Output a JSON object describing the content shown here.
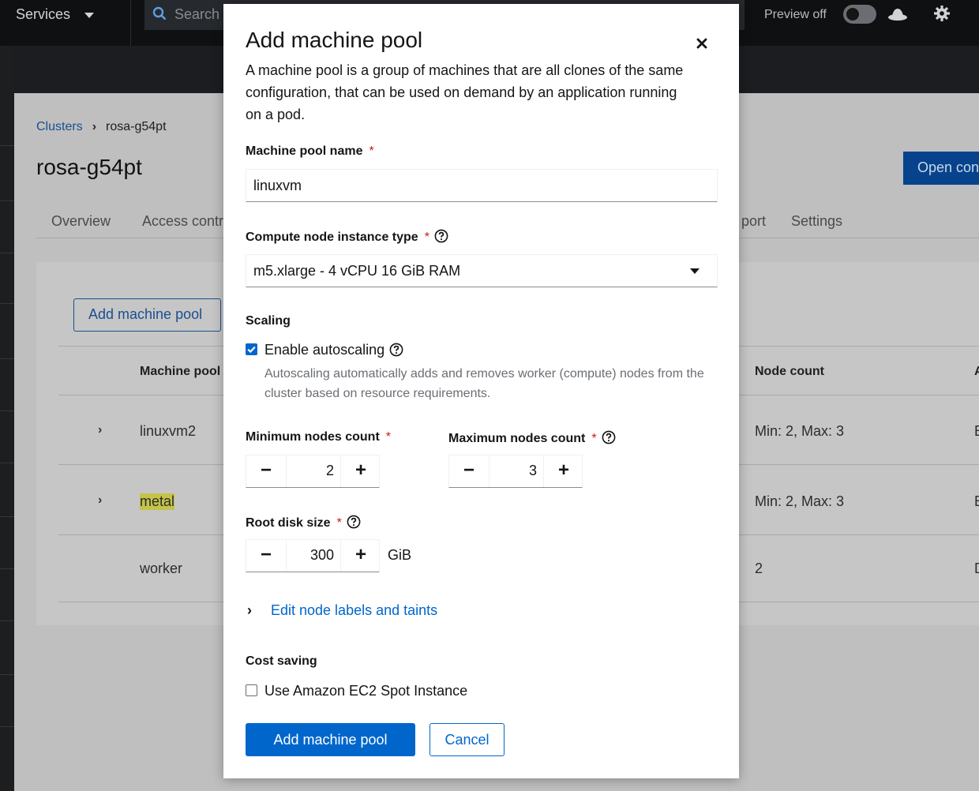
{
  "masthead": {
    "services_label": "Services",
    "search_placeholder": "Search",
    "preview_label": "Preview off"
  },
  "background": {
    "breadcrumb": {
      "parent": "Clusters",
      "current": "rosa-g54pt"
    },
    "page_title": "rosa-g54pt",
    "open_button": "Open con",
    "tabs": [
      "Overview",
      "Access contr",
      "port",
      "Settings"
    ],
    "add_button": "Add machine pool",
    "table": {
      "headers": [
        "Machine pool",
        "Node count",
        "A"
      ],
      "rows": [
        {
          "name": "linuxvm2",
          "node_count": "Min: 2, Max: 3",
          "extra": "E"
        },
        {
          "name": "metal",
          "node_count": "Min: 2, Max: 3",
          "extra": "E"
        },
        {
          "name": "worker",
          "node_count": "2",
          "extra": "D"
        }
      ]
    }
  },
  "modal": {
    "title": "Add machine pool",
    "description": "A machine pool is a group of machines that are all clones of the same configuration, that can be used on demand by an application running on a pod.",
    "name_label": "Machine pool name",
    "name_value": "linuxvm",
    "instance_label": "Compute node instance type",
    "instance_value": "m5.xlarge - 4 vCPU 16 GiB RAM",
    "scaling_label": "Scaling",
    "autoscaling_label": "Enable autoscaling",
    "autoscaling_checked": true,
    "autoscaling_helper": "Autoscaling automatically adds and removes worker (compute) nodes from the cluster based on resource requirements.",
    "min_label": "Minimum nodes count",
    "min_value": "2",
    "max_label": "Maximum nodes count",
    "max_value": "3",
    "disk_label": "Root disk size",
    "disk_value": "300",
    "disk_unit": "GiB",
    "labels_link": "Edit node labels and taints",
    "cost_label": "Cost saving",
    "spot_label": "Use Amazon EC2 Spot Instance",
    "spot_checked": false,
    "submit_label": "Add machine pool",
    "cancel_label": "Cancel",
    "required_mark": "*",
    "minus": "−",
    "plus": "+"
  },
  "colors": {
    "primary": "#0066cc",
    "required": "#c9190b",
    "highlight": "#c4c34a"
  }
}
